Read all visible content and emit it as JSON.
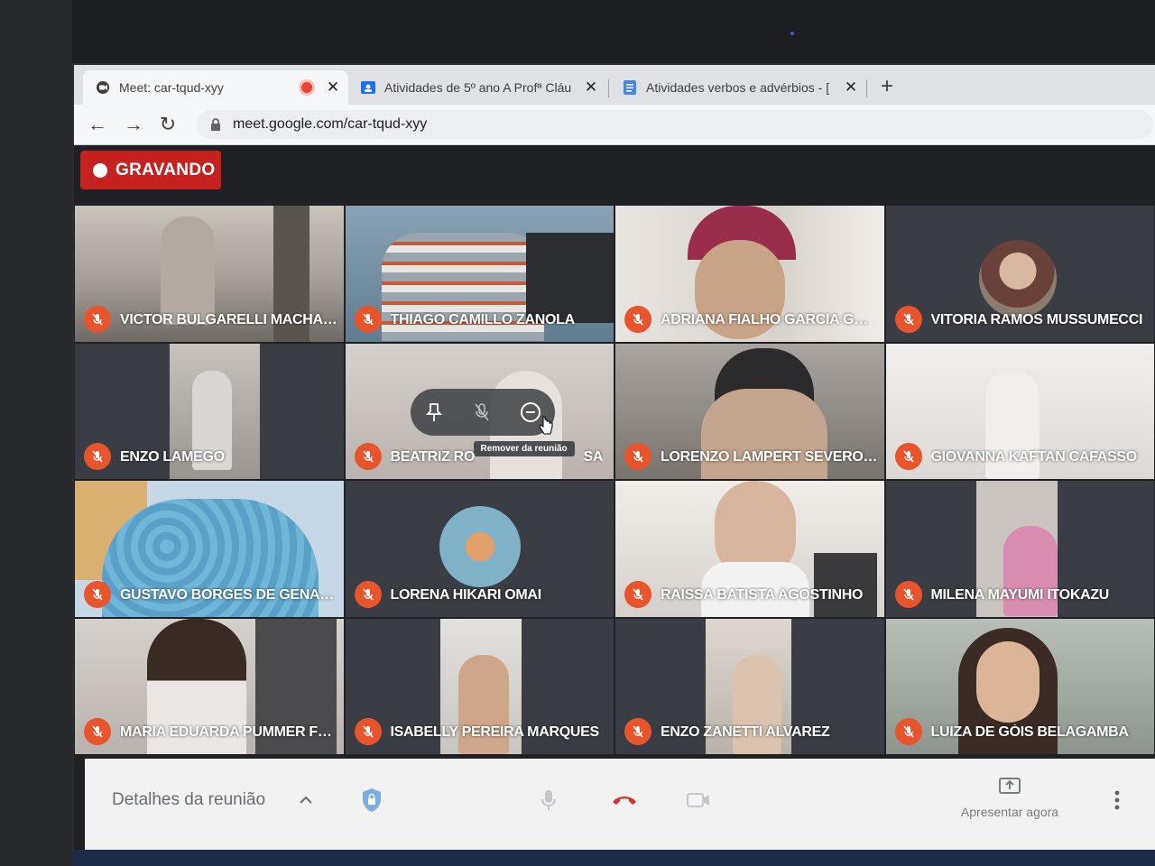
{
  "browser": {
    "tabs": [
      {
        "title": "Meet: car-tqud-xyy",
        "icon": "meet-icon",
        "active": true,
        "recording": true
      },
      {
        "title": "Atividades de 5º ano A Profª Cláu",
        "icon": "classroom-icon",
        "active": false
      },
      {
        "title": "Atividades verbos e advérbios - [",
        "icon": "docs-icon",
        "active": false
      }
    ],
    "new_tab_label": "+",
    "url": "meet.google.com/car-tqud-xyy"
  },
  "meet": {
    "recording_label": "GRAVANDO",
    "participants": [
      {
        "name": "VICTOR BULGARELLI MACHADO",
        "muted": true
      },
      {
        "name": "THIAGO CAMILLO ZANOLA",
        "muted": true
      },
      {
        "name": "ADRIANA FIALHO GARCIA GON...",
        "muted": true
      },
      {
        "name": "VITORIA RAMOS MUSSUMECCI",
        "muted": true
      },
      {
        "name": "ENZO LAMEGO",
        "muted": true
      },
      {
        "name": "BEATRIZ RO",
        "name_suffix": "SA",
        "muted": true
      },
      {
        "name": "LORENZO LAMPERT SEVERO D...",
        "muted": true
      },
      {
        "name": "GIOVANNA KAFTAN CAFASSO",
        "muted": true
      },
      {
        "name": "GUSTAVO BORGES DE GENARO",
        "muted": true
      },
      {
        "name": "LORENA HIKARI OMAI",
        "muted": true
      },
      {
        "name": "RAISSA BATISTA AGOSTINHO",
        "muted": true
      },
      {
        "name": "MILENA MAYUMI ITOKAZU",
        "muted": true
      },
      {
        "name": "MARIA EDUARDA PUMMER FRE...",
        "muted": true
      },
      {
        "name": "ISABELLY PEREIRA MARQUES",
        "muted": true
      },
      {
        "name": "ENZO ZANETTI ALVAREZ",
        "muted": true
      },
      {
        "name": "LUIZA DE GÓIS BELAGAMBA",
        "muted": true
      }
    ],
    "hover_tooltip": "Remover da reunião",
    "controls": {
      "details_label": "Detalhes da reunião",
      "present_label": "Apresentar agora"
    },
    "colors": {
      "recording_badge": "#c5221f",
      "mute_badge": "#e8542c",
      "hangup": "#d93025"
    }
  }
}
